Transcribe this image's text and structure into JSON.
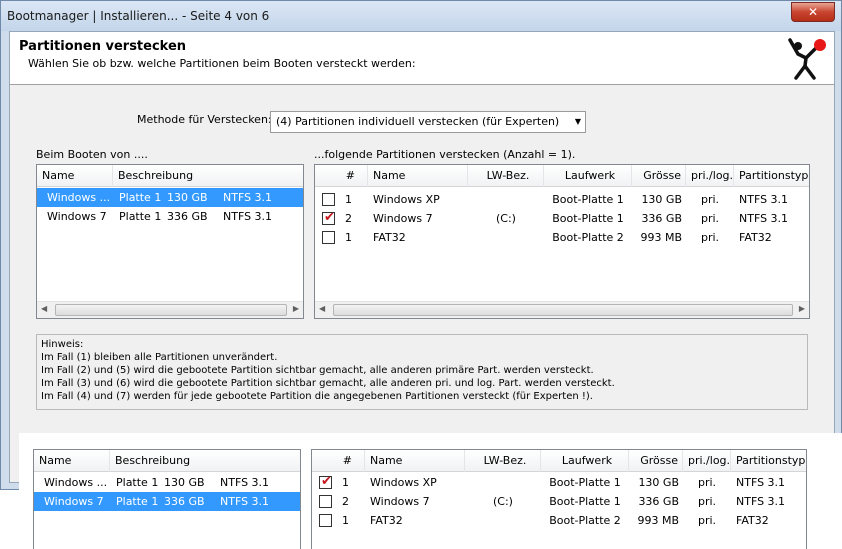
{
  "window": {
    "title": "Bootmanager | Installieren...  -  Seite 4 von 6",
    "close_label": "✕"
  },
  "header": {
    "title": "Partitionen verstecken",
    "subtitle": "Wählen Sie ob bzw. welche Partitionen beim Booten versteckt werden:"
  },
  "method": {
    "label": "Methode für Verstecken:",
    "selected": "(4) Partitionen individuell verstecken (für Experten)"
  },
  "left_panel": {
    "caption": "Beim Booten von ....",
    "columns": [
      "Name",
      "Beschreibung"
    ],
    "rows": [
      {
        "name": "Windows ...",
        "disk": "Platte 1",
        "size": "130 GB",
        "fs": "NTFS 3.1",
        "selected": true
      },
      {
        "name": "Windows 7",
        "disk": "Platte 1",
        "size": "336 GB",
        "fs": "NTFS 3.1",
        "selected": false
      }
    ]
  },
  "right_panel": {
    "caption": "...folgende Partitionen verstecken (Anzahl = 1).",
    "columns": [
      "#",
      "Name",
      "LW-Bez.",
      "Laufwerk",
      "Grösse",
      "pri./log.",
      "Partitionstyp"
    ],
    "rows": [
      {
        "checked": false,
        "num": "1",
        "name": "Windows XP",
        "drive_letter": "",
        "drive": "Boot-Platte 1",
        "size": "130 GB",
        "type": "pri.",
        "ptype": "NTFS 3.1"
      },
      {
        "checked": true,
        "num": "2",
        "name": "Windows 7",
        "drive_letter": "(C:)",
        "drive": "Boot-Platte 1",
        "size": "336 GB",
        "type": "pri.",
        "ptype": "NTFS 3.1"
      },
      {
        "checked": false,
        "num": "1",
        "name": "FAT32",
        "drive_letter": "",
        "drive": "Boot-Platte 2",
        "size": "993 MB",
        "type": "pri.",
        "ptype": "FAT32"
      }
    ]
  },
  "hint": {
    "lines": [
      "Hinweis:",
      "Im Fall (1) bleiben alle Partitionen unverändert.",
      "Im Fall (2) und (5) wird die gebootete Partition sichtbar gemacht, alle anderen primäre Part. werden versteckt.",
      "Im Fall (3) und (6) wird die gebootete Partition sichtbar gemacht, alle anderen pri. und log. Part. werden versteckt.",
      "Im Fall (4) und (7) werden für jede gebootete Partition die angegebenen Partitionen versteckt (für Experten !)."
    ]
  },
  "overlay_left": {
    "columns": [
      "Name",
      "Beschreibung"
    ],
    "rows": [
      {
        "name": "Windows ...",
        "disk": "Platte 1",
        "size": "130 GB",
        "fs": "NTFS 3.1",
        "selected": false
      },
      {
        "name": "Windows 7",
        "disk": "Platte 1",
        "size": "336 GB",
        "fs": "NTFS 3.1",
        "selected": true
      }
    ]
  },
  "overlay_right": {
    "columns": [
      "#",
      "Name",
      "LW-Bez.",
      "Laufwerk",
      "Grösse",
      "pri./log.",
      "Partitionstyp"
    ],
    "rows": [
      {
        "checked": true,
        "num": "1",
        "name": "Windows XP",
        "drive_letter": "",
        "drive": "Boot-Platte 1",
        "size": "130 GB",
        "type": "pri.",
        "ptype": "NTFS 3.1"
      },
      {
        "checked": false,
        "num": "2",
        "name": "Windows 7",
        "drive_letter": "(C:)",
        "drive": "Boot-Platte 1",
        "size": "336 GB",
        "type": "pri.",
        "ptype": "NTFS 3.1"
      },
      {
        "checked": false,
        "num": "1",
        "name": "FAT32",
        "drive_letter": "",
        "drive": "Boot-Platte 2",
        "size": "993 MB",
        "type": "pri.",
        "ptype": "FAT32"
      }
    ]
  }
}
